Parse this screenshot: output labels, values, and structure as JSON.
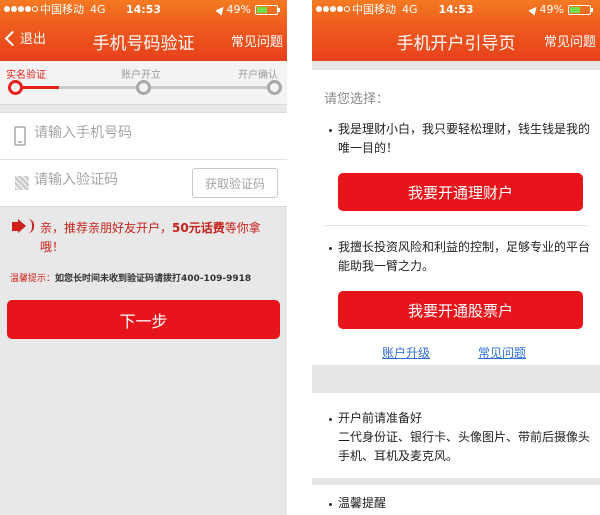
{
  "status_bar": {
    "carrier": "中国移动",
    "network": "4G",
    "time": "14:53",
    "battery_percent": "49%",
    "battery_level": 0.49
  },
  "left_screen": {
    "back_label": "退出",
    "title": "手机号码验证",
    "faq_label": "常见问题",
    "steps": [
      {
        "label": "实名验证",
        "active": true
      },
      {
        "label": "账户开立",
        "active": false
      },
      {
        "label": "开户确认",
        "active": false
      }
    ],
    "step_progress": 0.17,
    "phone_input": {
      "placeholder": "请输入手机号码",
      "value": ""
    },
    "code_input": {
      "placeholder": "请输入验证码",
      "value": ""
    },
    "get_code_button": "获取验证码",
    "promo": {
      "prefix": "亲，推荐亲朋好友开户，",
      "highlight": "50元话费",
      "suffix": "等你拿哦！"
    },
    "tip": {
      "label": "温馨提示：",
      "text": "如您长时间未收到验证码请拨打",
      "phone": "400-109-9918"
    },
    "next_button": "下一步"
  },
  "right_screen": {
    "title": "手机开户引导页",
    "faq_label": "常见问题",
    "prompt": "请您选择：",
    "option1": {
      "text": "我是理财小白，我只要轻松理财，钱生钱是我的唯一目的！",
      "button": "我要开通理财户"
    },
    "option2": {
      "text": "我擅长投资风险和利益的控制，足够专业的平台能助我一臂之力。",
      "button": "我要开通股票户"
    },
    "links": {
      "upgrade": "账户升级",
      "faq": "常见问题"
    },
    "prep": {
      "title": "开户前请准备好",
      "text": "二代身份证、银行卡、头像图片、带前后摄像头手机、耳机及麦克风。"
    },
    "tips_title": "温馨提醒"
  },
  "colors": {
    "header_top": "#f47a22",
    "header_bottom": "#e7401b",
    "primary_red": "#e8141b",
    "link_blue": "#2f6fd6"
  }
}
